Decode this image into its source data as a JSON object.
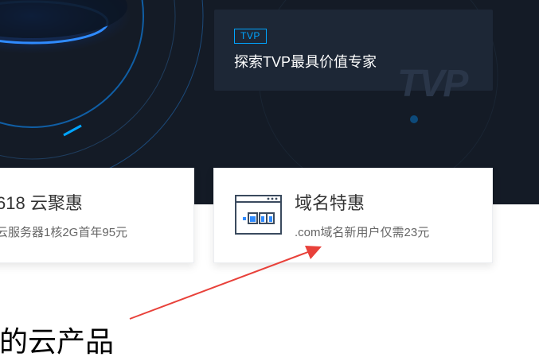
{
  "banner": {
    "tvp_card": {
      "tag": "TVP",
      "title": "探索TVP最具价值专家",
      "watermark": "TVP"
    }
  },
  "promos": [
    {
      "title": "618 云聚惠",
      "desc": "云服务器1核2G首年95元"
    },
    {
      "title": "域名特惠",
      "desc": ".com域名新用户仅需23元",
      "icon": "domain-com-icon"
    }
  ],
  "section": {
    "heading": "的云产品"
  },
  "colors": {
    "hero_bg": "#141b26",
    "accent": "#00a4ff",
    "annotation_arrow": "#e8413a"
  }
}
